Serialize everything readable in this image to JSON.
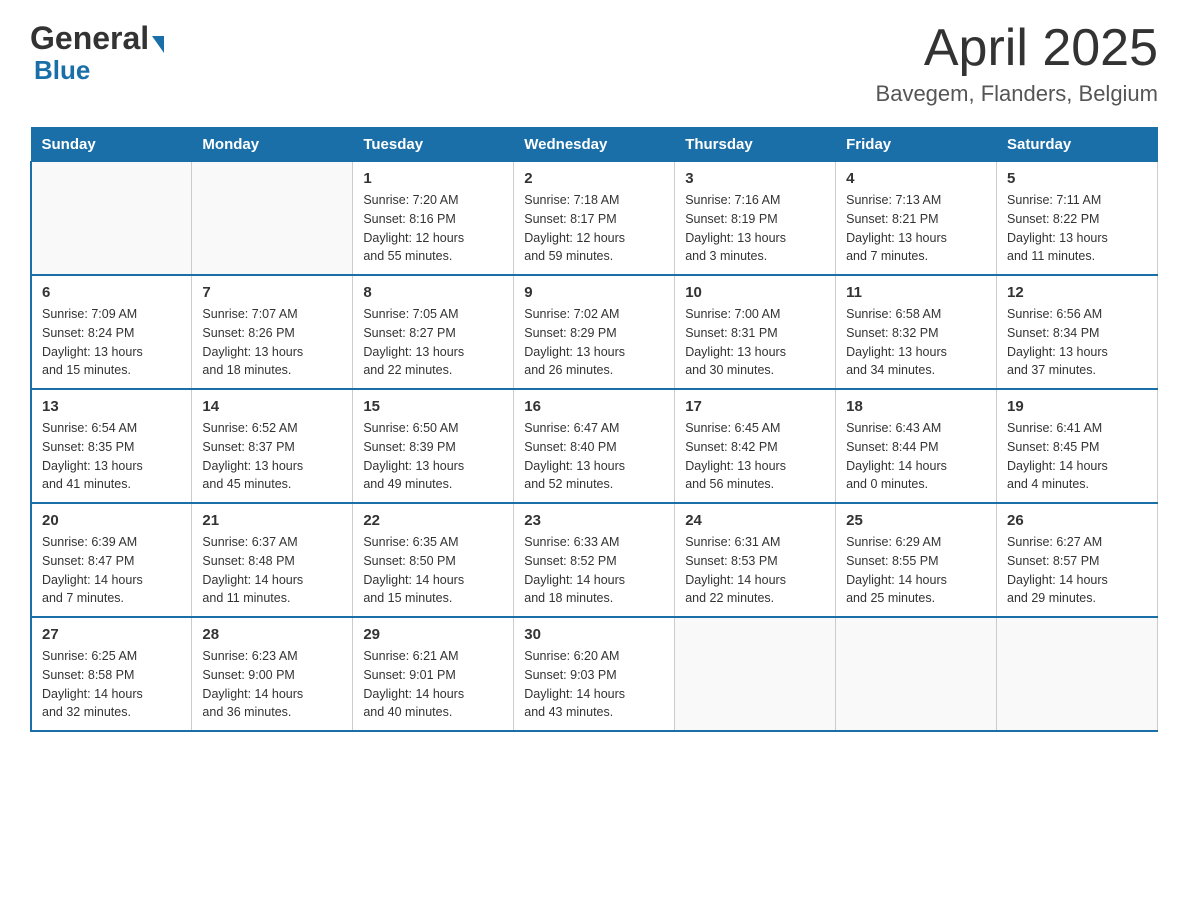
{
  "header": {
    "logo_general": "General",
    "logo_blue": "Blue",
    "month_title": "April 2025",
    "location": "Bavegem, Flanders, Belgium"
  },
  "days_of_week": [
    "Sunday",
    "Monday",
    "Tuesday",
    "Wednesday",
    "Thursday",
    "Friday",
    "Saturday"
  ],
  "weeks": [
    [
      {
        "day": "",
        "info": ""
      },
      {
        "day": "",
        "info": ""
      },
      {
        "day": "1",
        "info": "Sunrise: 7:20 AM\nSunset: 8:16 PM\nDaylight: 12 hours\nand 55 minutes."
      },
      {
        "day": "2",
        "info": "Sunrise: 7:18 AM\nSunset: 8:17 PM\nDaylight: 12 hours\nand 59 minutes."
      },
      {
        "day": "3",
        "info": "Sunrise: 7:16 AM\nSunset: 8:19 PM\nDaylight: 13 hours\nand 3 minutes."
      },
      {
        "day": "4",
        "info": "Sunrise: 7:13 AM\nSunset: 8:21 PM\nDaylight: 13 hours\nand 7 minutes."
      },
      {
        "day": "5",
        "info": "Sunrise: 7:11 AM\nSunset: 8:22 PM\nDaylight: 13 hours\nand 11 minutes."
      }
    ],
    [
      {
        "day": "6",
        "info": "Sunrise: 7:09 AM\nSunset: 8:24 PM\nDaylight: 13 hours\nand 15 minutes."
      },
      {
        "day": "7",
        "info": "Sunrise: 7:07 AM\nSunset: 8:26 PM\nDaylight: 13 hours\nand 18 minutes."
      },
      {
        "day": "8",
        "info": "Sunrise: 7:05 AM\nSunset: 8:27 PM\nDaylight: 13 hours\nand 22 minutes."
      },
      {
        "day": "9",
        "info": "Sunrise: 7:02 AM\nSunset: 8:29 PM\nDaylight: 13 hours\nand 26 minutes."
      },
      {
        "day": "10",
        "info": "Sunrise: 7:00 AM\nSunset: 8:31 PM\nDaylight: 13 hours\nand 30 minutes."
      },
      {
        "day": "11",
        "info": "Sunrise: 6:58 AM\nSunset: 8:32 PM\nDaylight: 13 hours\nand 34 minutes."
      },
      {
        "day": "12",
        "info": "Sunrise: 6:56 AM\nSunset: 8:34 PM\nDaylight: 13 hours\nand 37 minutes."
      }
    ],
    [
      {
        "day": "13",
        "info": "Sunrise: 6:54 AM\nSunset: 8:35 PM\nDaylight: 13 hours\nand 41 minutes."
      },
      {
        "day": "14",
        "info": "Sunrise: 6:52 AM\nSunset: 8:37 PM\nDaylight: 13 hours\nand 45 minutes."
      },
      {
        "day": "15",
        "info": "Sunrise: 6:50 AM\nSunset: 8:39 PM\nDaylight: 13 hours\nand 49 minutes."
      },
      {
        "day": "16",
        "info": "Sunrise: 6:47 AM\nSunset: 8:40 PM\nDaylight: 13 hours\nand 52 minutes."
      },
      {
        "day": "17",
        "info": "Sunrise: 6:45 AM\nSunset: 8:42 PM\nDaylight: 13 hours\nand 56 minutes."
      },
      {
        "day": "18",
        "info": "Sunrise: 6:43 AM\nSunset: 8:44 PM\nDaylight: 14 hours\nand 0 minutes."
      },
      {
        "day": "19",
        "info": "Sunrise: 6:41 AM\nSunset: 8:45 PM\nDaylight: 14 hours\nand 4 minutes."
      }
    ],
    [
      {
        "day": "20",
        "info": "Sunrise: 6:39 AM\nSunset: 8:47 PM\nDaylight: 14 hours\nand 7 minutes."
      },
      {
        "day": "21",
        "info": "Sunrise: 6:37 AM\nSunset: 8:48 PM\nDaylight: 14 hours\nand 11 minutes."
      },
      {
        "day": "22",
        "info": "Sunrise: 6:35 AM\nSunset: 8:50 PM\nDaylight: 14 hours\nand 15 minutes."
      },
      {
        "day": "23",
        "info": "Sunrise: 6:33 AM\nSunset: 8:52 PM\nDaylight: 14 hours\nand 18 minutes."
      },
      {
        "day": "24",
        "info": "Sunrise: 6:31 AM\nSunset: 8:53 PM\nDaylight: 14 hours\nand 22 minutes."
      },
      {
        "day": "25",
        "info": "Sunrise: 6:29 AM\nSunset: 8:55 PM\nDaylight: 14 hours\nand 25 minutes."
      },
      {
        "day": "26",
        "info": "Sunrise: 6:27 AM\nSunset: 8:57 PM\nDaylight: 14 hours\nand 29 minutes."
      }
    ],
    [
      {
        "day": "27",
        "info": "Sunrise: 6:25 AM\nSunset: 8:58 PM\nDaylight: 14 hours\nand 32 minutes."
      },
      {
        "day": "28",
        "info": "Sunrise: 6:23 AM\nSunset: 9:00 PM\nDaylight: 14 hours\nand 36 minutes."
      },
      {
        "day": "29",
        "info": "Sunrise: 6:21 AM\nSunset: 9:01 PM\nDaylight: 14 hours\nand 40 minutes."
      },
      {
        "day": "30",
        "info": "Sunrise: 6:20 AM\nSunset: 9:03 PM\nDaylight: 14 hours\nand 43 minutes."
      },
      {
        "day": "",
        "info": ""
      },
      {
        "day": "",
        "info": ""
      },
      {
        "day": "",
        "info": ""
      }
    ]
  ]
}
